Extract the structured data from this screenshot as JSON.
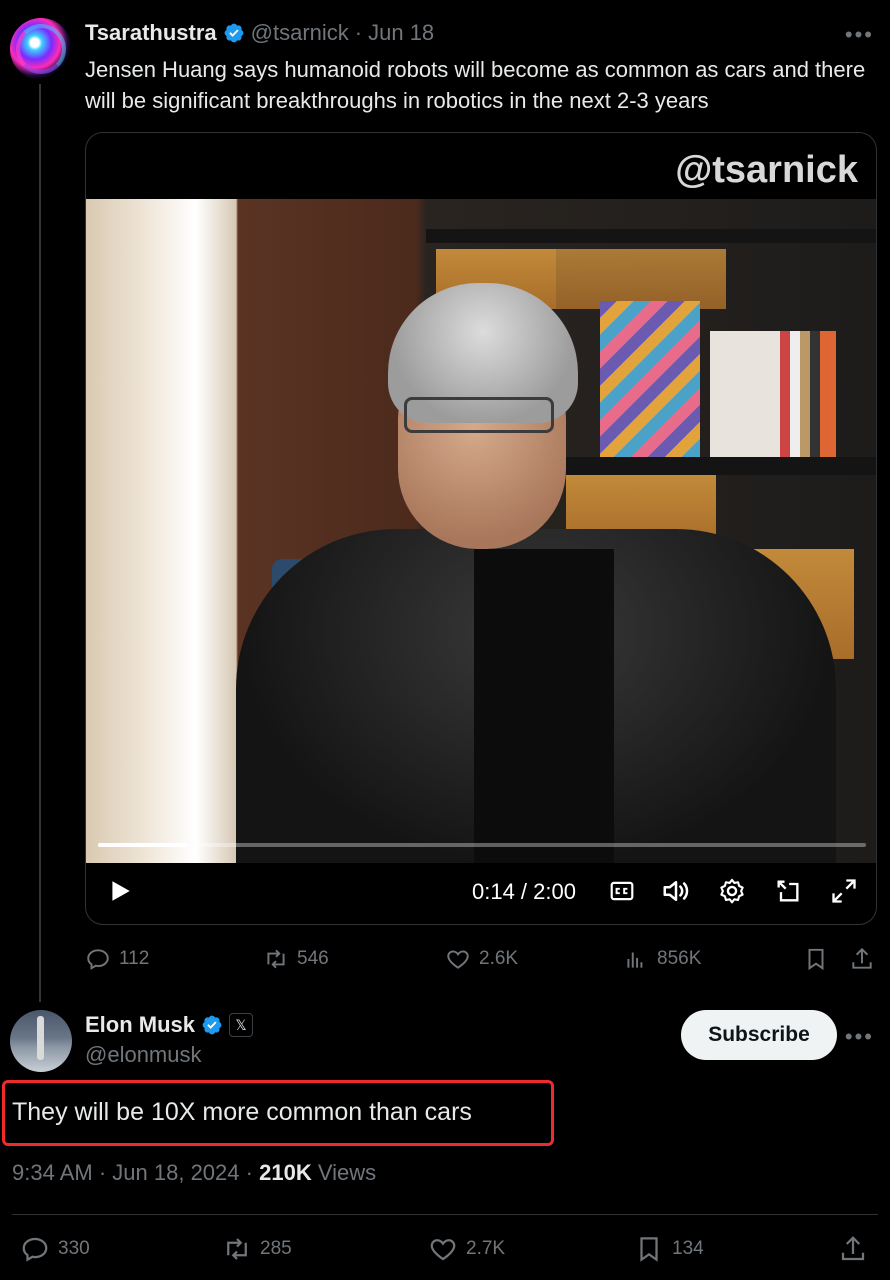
{
  "original_tweet": {
    "author_name": "Tsarathustra",
    "handle": "@tsarnick",
    "separator": "·",
    "date": "Jun 18",
    "text": "Jensen Huang says humanoid robots will become as common as cars and there will be significant breakthroughs in robotics in the next 2-3 years",
    "media": {
      "watermark": "@tsarnick",
      "time_display": "0:14 / 2:00",
      "progress_fraction": 0.117
    },
    "stats": {
      "replies": "112",
      "reposts": "546",
      "likes": "2.6K",
      "views": "856K"
    }
  },
  "reply_tweet": {
    "author_name": "Elon Musk",
    "handle": "@elonmusk",
    "x_badge": "𝕏",
    "subscribe_label": "Subscribe",
    "text": "They will be 10X more common than cars",
    "time": "9:34 AM",
    "date": "Jun 18, 2024",
    "separator": "·",
    "views_count": "210K",
    "views_label": "Views",
    "stats": {
      "replies": "330",
      "reposts": "285",
      "likes": "2.7K",
      "bookmarks": "134"
    }
  },
  "colors": {
    "background": "#000000",
    "text": "#e7e9ea",
    "secondary": "#71767b",
    "verified": "#1d9bf0",
    "highlight_box": "#ef2b2b"
  }
}
